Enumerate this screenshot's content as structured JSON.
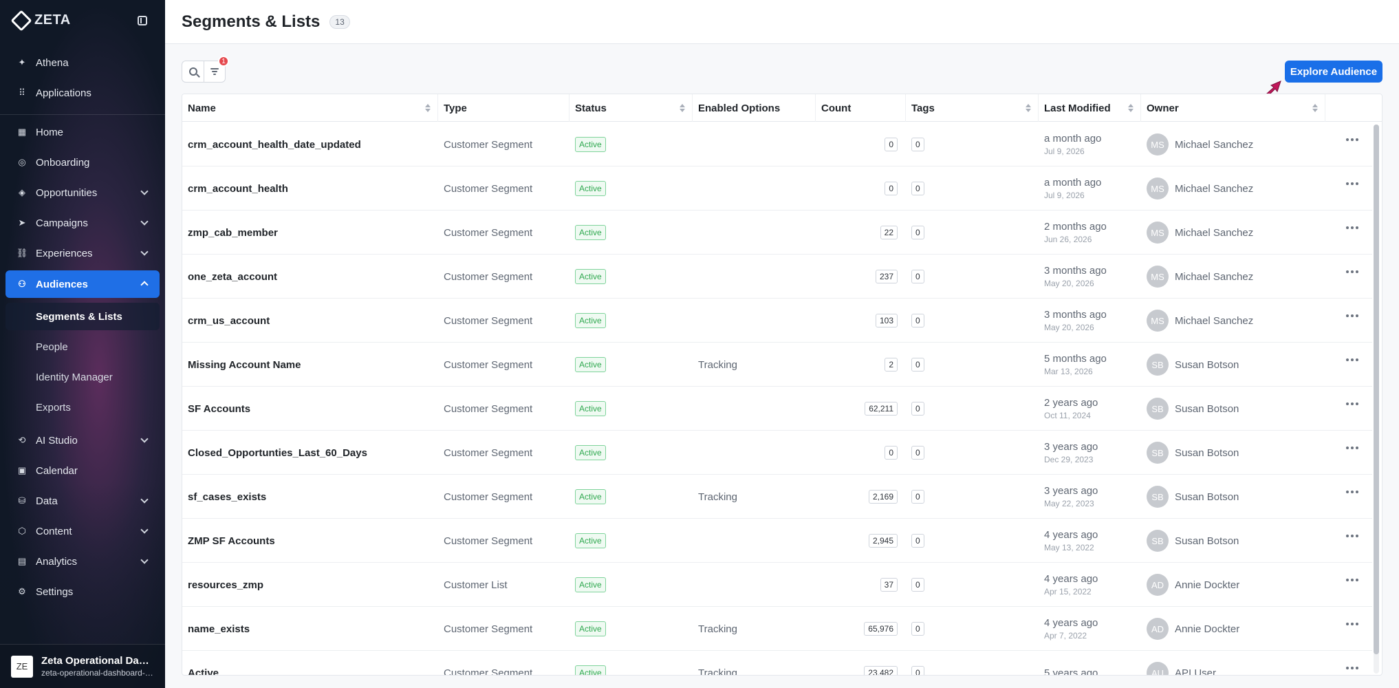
{
  "brand": {
    "name": "ZETA"
  },
  "sidebar": {
    "top_items": [
      {
        "label": "Athena",
        "icon": "sparkle-icon"
      },
      {
        "label": "Applications",
        "icon": "grid-icon"
      }
    ],
    "items": [
      {
        "label": "Home",
        "icon": "dashboard-icon",
        "has_children": false
      },
      {
        "label": "Onboarding",
        "icon": "compass-icon",
        "has_children": false
      },
      {
        "label": "Opportunities",
        "icon": "target-icon",
        "has_children": true
      },
      {
        "label": "Campaigns",
        "icon": "send-icon",
        "has_children": true
      },
      {
        "label": "Experiences",
        "icon": "flow-icon",
        "has_children": true
      },
      {
        "label": "Audiences",
        "icon": "audience-icon",
        "has_children": true,
        "active": true
      },
      {
        "label": "AI Studio",
        "icon": "ai-icon",
        "has_children": true
      },
      {
        "label": "Calendar",
        "icon": "calendar-icon",
        "has_children": false
      },
      {
        "label": "Data",
        "icon": "database-icon",
        "has_children": true
      },
      {
        "label": "Content",
        "icon": "content-icon",
        "has_children": true
      },
      {
        "label": "Analytics",
        "icon": "analytics-icon",
        "has_children": true
      },
      {
        "label": "Settings",
        "icon": "gear-icon",
        "has_children": false
      }
    ],
    "audience_sub_items": [
      {
        "label": "Segments & Lists",
        "selected": true
      },
      {
        "label": "People",
        "selected": false
      },
      {
        "label": "Identity Manager",
        "selected": false
      },
      {
        "label": "Exports",
        "selected": false
      }
    ],
    "workspace": {
      "avatar": "ZE",
      "title": "Zeta Operational Dashboard",
      "subtitle": "zeta-operational-dashboard-demo"
    }
  },
  "header": {
    "title": "Segments & Lists",
    "count": "13"
  },
  "toolbar": {
    "filter_count": "1",
    "explore_label": "Explore Audience"
  },
  "table": {
    "columns": [
      "Name",
      "Type",
      "Status",
      "Enabled Options",
      "Count",
      "Tags",
      "Last Modified",
      "Owner"
    ],
    "rows": [
      {
        "name": "crm_account_health_date_updated",
        "type": "Customer Segment",
        "status": "Active",
        "enabled": "",
        "count": "0",
        "tags": "0",
        "modified": "a month ago",
        "modified_date": "Jul 9, 2026",
        "owner_initials": "MS",
        "owner": "Michael Sanchez"
      },
      {
        "name": "crm_account_health",
        "type": "Customer Segment",
        "status": "Active",
        "enabled": "",
        "count": "0",
        "tags": "0",
        "modified": "a month ago",
        "modified_date": "Jul 9, 2026",
        "owner_initials": "MS",
        "owner": "Michael Sanchez"
      },
      {
        "name": "zmp_cab_member",
        "type": "Customer Segment",
        "status": "Active",
        "enabled": "",
        "count": "22",
        "tags": "0",
        "modified": "2 months ago",
        "modified_date": "Jun 26, 2026",
        "owner_initials": "MS",
        "owner": "Michael Sanchez"
      },
      {
        "name": "one_zeta_account",
        "type": "Customer Segment",
        "status": "Active",
        "enabled": "",
        "count": "237",
        "tags": "0",
        "modified": "3 months ago",
        "modified_date": "May 20, 2026",
        "owner_initials": "MS",
        "owner": "Michael Sanchez"
      },
      {
        "name": "crm_us_account",
        "type": "Customer Segment",
        "status": "Active",
        "enabled": "",
        "count": "103",
        "tags": "0",
        "modified": "3 months ago",
        "modified_date": "May 20, 2026",
        "owner_initials": "MS",
        "owner": "Michael Sanchez"
      },
      {
        "name": "Missing Account Name",
        "type": "Customer Segment",
        "status": "Active",
        "enabled": "Tracking",
        "count": "2",
        "tags": "0",
        "modified": "5 months ago",
        "modified_date": "Mar 13, 2026",
        "owner_initials": "SB",
        "owner": "Susan Botson"
      },
      {
        "name": "SF Accounts",
        "type": "Customer Segment",
        "status": "Active",
        "enabled": "",
        "count": "62,211",
        "tags": "0",
        "modified": "2 years ago",
        "modified_date": "Oct 11, 2024",
        "owner_initials": "SB",
        "owner": "Susan Botson"
      },
      {
        "name": "Closed_Opportunties_Last_60_Days",
        "type": "Customer Segment",
        "status": "Active",
        "enabled": "",
        "count": "0",
        "tags": "0",
        "modified": "3 years ago",
        "modified_date": "Dec 29, 2023",
        "owner_initials": "SB",
        "owner": "Susan Botson"
      },
      {
        "name": "sf_cases_exists",
        "type": "Customer Segment",
        "status": "Active",
        "enabled": "Tracking",
        "count": "2,169",
        "tags": "0",
        "modified": "3 years ago",
        "modified_date": "May 22, 2023",
        "owner_initials": "SB",
        "owner": "Susan Botson"
      },
      {
        "name": "ZMP SF Accounts",
        "type": "Customer Segment",
        "status": "Active",
        "enabled": "",
        "count": "2,945",
        "tags": "0",
        "modified": "4 years ago",
        "modified_date": "May 13, 2022",
        "owner_initials": "SB",
        "owner": "Susan Botson"
      },
      {
        "name": "resources_zmp",
        "type": "Customer List",
        "status": "Active",
        "enabled": "",
        "count": "37",
        "tags": "0",
        "modified": "4 years ago",
        "modified_date": "Apr 15, 2022",
        "owner_initials": "AD",
        "owner": "Annie Dockter"
      },
      {
        "name": "name_exists",
        "type": "Customer Segment",
        "status": "Active",
        "enabled": "Tracking",
        "count": "65,976",
        "tags": "0",
        "modified": "4 years ago",
        "modified_date": "Apr 7, 2022",
        "owner_initials": "AD",
        "owner": "Annie Dockter"
      },
      {
        "name": "Active",
        "type": "Customer Segment",
        "status": "Active",
        "enabled": "Tracking",
        "count": "23,482",
        "tags": "0",
        "modified": "5 years ago",
        "modified_date": "",
        "owner_initials": "AU",
        "owner": "API User"
      }
    ]
  },
  "colors": {
    "accent": "#1a6fe8",
    "status_green": "#2fa84f",
    "notification": "#e5484d"
  }
}
